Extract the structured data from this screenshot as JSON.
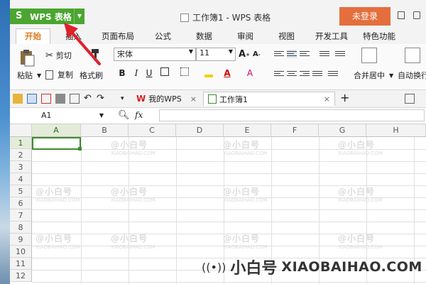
{
  "app": {
    "menu_button": "WPS 表格",
    "menu_logo": "S",
    "window_title": "工作簿1 - WPS 表格",
    "login_button": "未登录"
  },
  "menu_tabs": [
    "开始",
    "插入",
    "页面布局",
    "公式",
    "数据",
    "审阅",
    "视图",
    "开发工具",
    "特色功能"
  ],
  "ribbon": {
    "paste": "粘贴",
    "cut": "剪切",
    "copy": "复制",
    "format_painter": "格式刷",
    "font_name": "宋体",
    "font_size": "11",
    "bold": "B",
    "italic": "I",
    "underline": "U",
    "grow_font": "A",
    "shrink_font": "A",
    "font_color": "A",
    "merge_center": "合并居中",
    "wrap_text": "自动换行"
  },
  "doc_tabs": {
    "my_wps": "我的WPS",
    "workbook": "工作簿1",
    "close": "×",
    "add": "+"
  },
  "formula_bar": {
    "name_box": "A1",
    "fx": "fx"
  },
  "grid": {
    "columns": [
      "A",
      "B",
      "C",
      "D",
      "E",
      "F",
      "G",
      "H"
    ],
    "rows": [
      "1",
      "2",
      "3",
      "4",
      "5",
      "6",
      "7",
      "8",
      "9",
      "10",
      "11",
      "12"
    ],
    "selected_cell": "A1"
  },
  "watermark": {
    "cn": "小白号",
    "en": "XIAOBAIHAO.COM",
    "grid_text": "@小白号",
    "grid_text_en": "XIAOBAIHAO.COM"
  },
  "colors": {
    "wps_green": "#4aa62f",
    "login_orange": "#e46f3c",
    "active_tab": "#e07a1f",
    "selection": "#3d8b2d",
    "arrow": "#e0202a"
  }
}
